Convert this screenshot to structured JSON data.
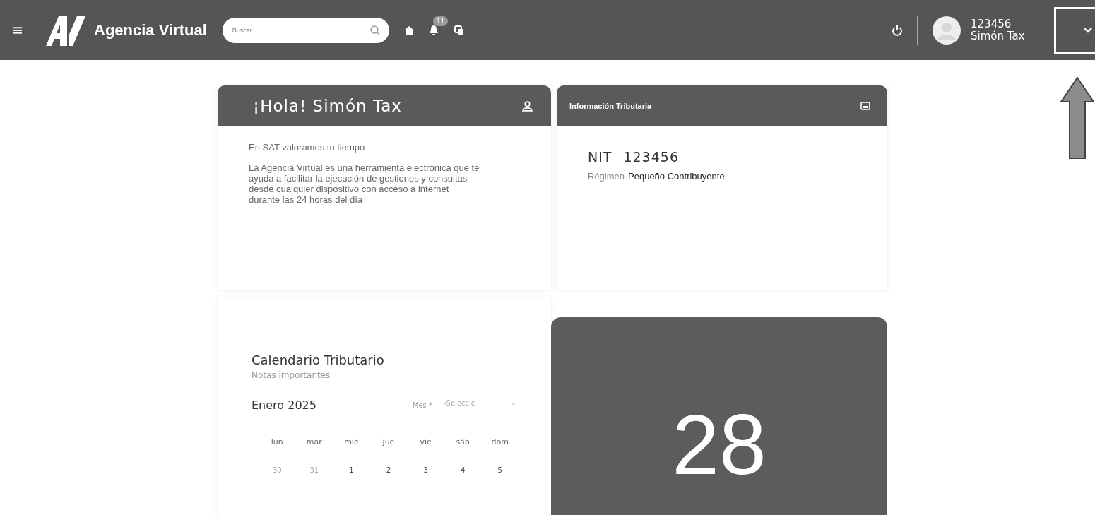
{
  "header": {
    "brand": "Agencia Virtual",
    "search": {
      "placeholder": "Buscar"
    },
    "notification_count": "11",
    "user": {
      "id": "123456",
      "name": "Simón Tax"
    }
  },
  "welcome_card": {
    "title": "¡Hola! Simón Tax",
    "tagline": "En SAT valoramos tu tiempo",
    "description": "La Agencia Virtual es una herramienta electrónica que te ayuda a facilitar la ejecución de gestiones y consultas desde cualquier dispositivo con acceso a internet durante las 24 horas del día"
  },
  "tax_info_card": {
    "title": "Información Tributaria",
    "nit_label": "NIT",
    "nit": "123456",
    "regime_label": "Régimen",
    "regime": "Pequeño Contribuyente"
  },
  "calendar": {
    "title": "Calendario Tributario",
    "notes_link": "Notas importantes",
    "month": "Enero 2025",
    "month_label": "Mes *",
    "month_select": "-Seleccic",
    "weekdays": [
      "lun",
      "mar",
      "mié",
      "jue",
      "vie",
      "sáb",
      "dom"
    ],
    "days": [
      {
        "label": "30",
        "outside": true
      },
      {
        "label": "31",
        "outside": true
      },
      {
        "label": "1",
        "outside": false
      },
      {
        "label": "2",
        "outside": false
      },
      {
        "label": "3",
        "outside": false
      },
      {
        "label": "4",
        "outside": false
      },
      {
        "label": "5",
        "outside": false
      }
    ]
  },
  "date_card": {
    "day": "28"
  }
}
